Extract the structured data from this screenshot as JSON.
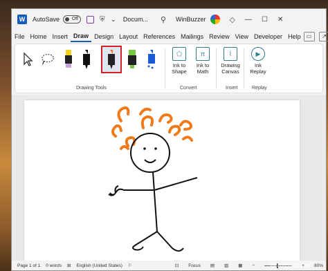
{
  "titlebar": {
    "autosave_label": "AutoSave",
    "autosave_state": "Off",
    "doc_name": "Docum...",
    "user_name": "WinBuzzer"
  },
  "menu": {
    "tabs": [
      "File",
      "Home",
      "Insert",
      "Draw",
      "Design",
      "Layout",
      "References",
      "Mailings",
      "Review",
      "View",
      "Developer",
      "Help"
    ],
    "active_tab": "Draw"
  },
  "ribbon": {
    "drawing_tools_label": "Drawing Tools",
    "convert_label": "Convert",
    "insert_label": "Insert",
    "replay_label": "Replay",
    "ink_to_shape": "Ink to Shape",
    "ink_to_math": "Ink to Math",
    "drawing_canvas": "Drawing Canvas",
    "ink_replay": "Ink Replay",
    "pen_colors": {
      "highlighter_yellow": "#f2d41a",
      "black_pen": "#111111",
      "orange_pen": "#f07a1a",
      "green_highlighter": "#7ac943",
      "blue_pen": "#1a5bd6"
    }
  },
  "status": {
    "page": "Page 1 of 1",
    "words": "0 words",
    "language": "English (United States)",
    "focus": "Focus",
    "zoom": "80%"
  },
  "watermark": "WinBuzzer"
}
